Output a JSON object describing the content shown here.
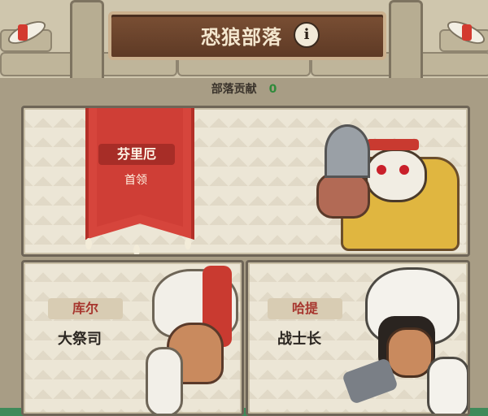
{
  "header": {
    "title": "恐狼部落",
    "info_icon": "info-icon"
  },
  "contribution": {
    "label": "部落贡献",
    "value": "0"
  },
  "leader": {
    "name": "芬里厄",
    "role": "首领",
    "banner_color": "#d6453c"
  },
  "members": [
    {
      "name": "库尔",
      "role": "大祭司"
    },
    {
      "name": "哈提",
      "role": "战士长"
    }
  ]
}
